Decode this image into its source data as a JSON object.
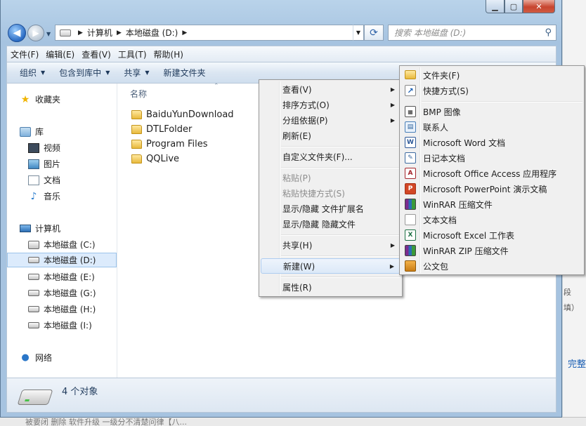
{
  "window": {
    "caption_buttons": {
      "minimize": "▁",
      "maximize": "▢",
      "close": "✕"
    }
  },
  "address_bar": {
    "crumbs": [
      "计算机",
      "本地磁盘 (D:)"
    ],
    "search_placeholder": "搜索 本地磁盘 (D:)"
  },
  "menu_bar": [
    "文件(F)",
    "编辑(E)",
    "查看(V)",
    "工具(T)",
    "帮助(H)"
  ],
  "toolbar": {
    "organize": "组织",
    "include_in_library": "包含到库中",
    "share": "共享",
    "new_folder": "新建文件夹"
  },
  "nav_pane": {
    "favorites": "收藏夹",
    "libraries": "库",
    "library_items": [
      "视频",
      "图片",
      "文档",
      "音乐"
    ],
    "computer": "计算机",
    "drives": [
      "本地磁盘 (C:)",
      "本地磁盘 (D:)",
      "本地磁盘 (E:)",
      "本地磁盘 (G:)",
      "本地磁盘 (H:)",
      "本地磁盘 (I:)"
    ],
    "selected_drive": "本地磁盘 (D:)",
    "network": "网络"
  },
  "content": {
    "column_header": "名称",
    "files": [
      "BaiduYunDownload",
      "DTLFolder",
      "Program Files",
      "QQLive"
    ]
  },
  "status_bar": {
    "count_text": "4 个对象"
  },
  "context_menu": {
    "items": [
      {
        "label": "查看(V)",
        "submenu": true
      },
      {
        "label": "排序方式(O)",
        "submenu": true
      },
      {
        "label": "分组依据(P)",
        "submenu": true
      },
      {
        "label": "刷新(E)"
      },
      {
        "label": "自定义文件夹(F)..."
      },
      {
        "label": "粘贴(P)",
        "disabled": true
      },
      {
        "label": "粘贴快捷方式(S)",
        "disabled": true
      },
      {
        "label": "显示/隐藏 文件扩展名"
      },
      {
        "label": "显示/隐藏 隐藏文件"
      },
      {
        "label": "共享(H)",
        "submenu": true
      },
      {
        "label": "新建(W)",
        "submenu": true,
        "highlighted": true
      },
      {
        "label": "属性(R)"
      }
    ]
  },
  "new_submenu": {
    "items": [
      {
        "label": "文件夹(F)",
        "icon": "folder-icon"
      },
      {
        "label": "快捷方式(S)",
        "icon": "shortcut-icon"
      },
      {
        "label": "BMP 图像",
        "icon": "bmp-image-icon"
      },
      {
        "label": "联系人",
        "icon": "contact-icon"
      },
      {
        "label": "Microsoft Word 文档",
        "icon": "word-document-icon"
      },
      {
        "label": "日记本文档",
        "icon": "journal-document-icon"
      },
      {
        "label": "Microsoft Office Access 应用程序",
        "icon": "access-icon"
      },
      {
        "label": "Microsoft PowerPoint 演示文稿",
        "icon": "powerpoint-icon"
      },
      {
        "label": "WinRAR 压缩文件",
        "icon": "winrar-icon"
      },
      {
        "label": "文本文档",
        "icon": "text-document-icon"
      },
      {
        "label": "Microsoft Excel 工作表",
        "icon": "excel-icon"
      },
      {
        "label": "WinRAR ZIP 压缩文件",
        "icon": "winrar-zip-icon"
      },
      {
        "label": "公文包",
        "icon": "briefcase-icon"
      }
    ]
  },
  "background_window": {
    "fragments": [
      "段",
      "填）",
      "完整"
    ],
    "bottom_text": "被要闭 删除   软件升级   一级分不清楚问律【八..."
  }
}
